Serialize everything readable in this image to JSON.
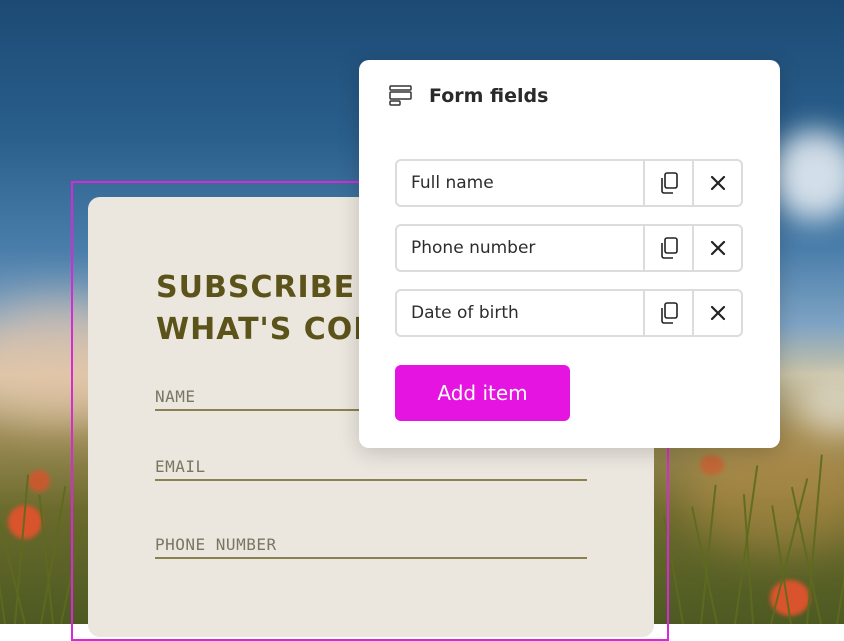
{
  "form_card": {
    "title": "SUBSCRIBE\nWHAT'S CON",
    "fields": [
      {
        "label": "NAME"
      },
      {
        "label": "EMAIL"
      },
      {
        "label": "PHONE NUMBER"
      }
    ]
  },
  "panel": {
    "title": "Form fields",
    "icon": "form-fields-icon",
    "items": [
      {
        "label": "Full name"
      },
      {
        "label": "Phone number"
      },
      {
        "label": "Date of birth"
      }
    ],
    "add_label": "Add item"
  },
  "colors": {
    "accent": "#e614e0",
    "selection": "#d72ad7",
    "form_title": "#5c531a",
    "form_bg": "#ebe7df"
  }
}
